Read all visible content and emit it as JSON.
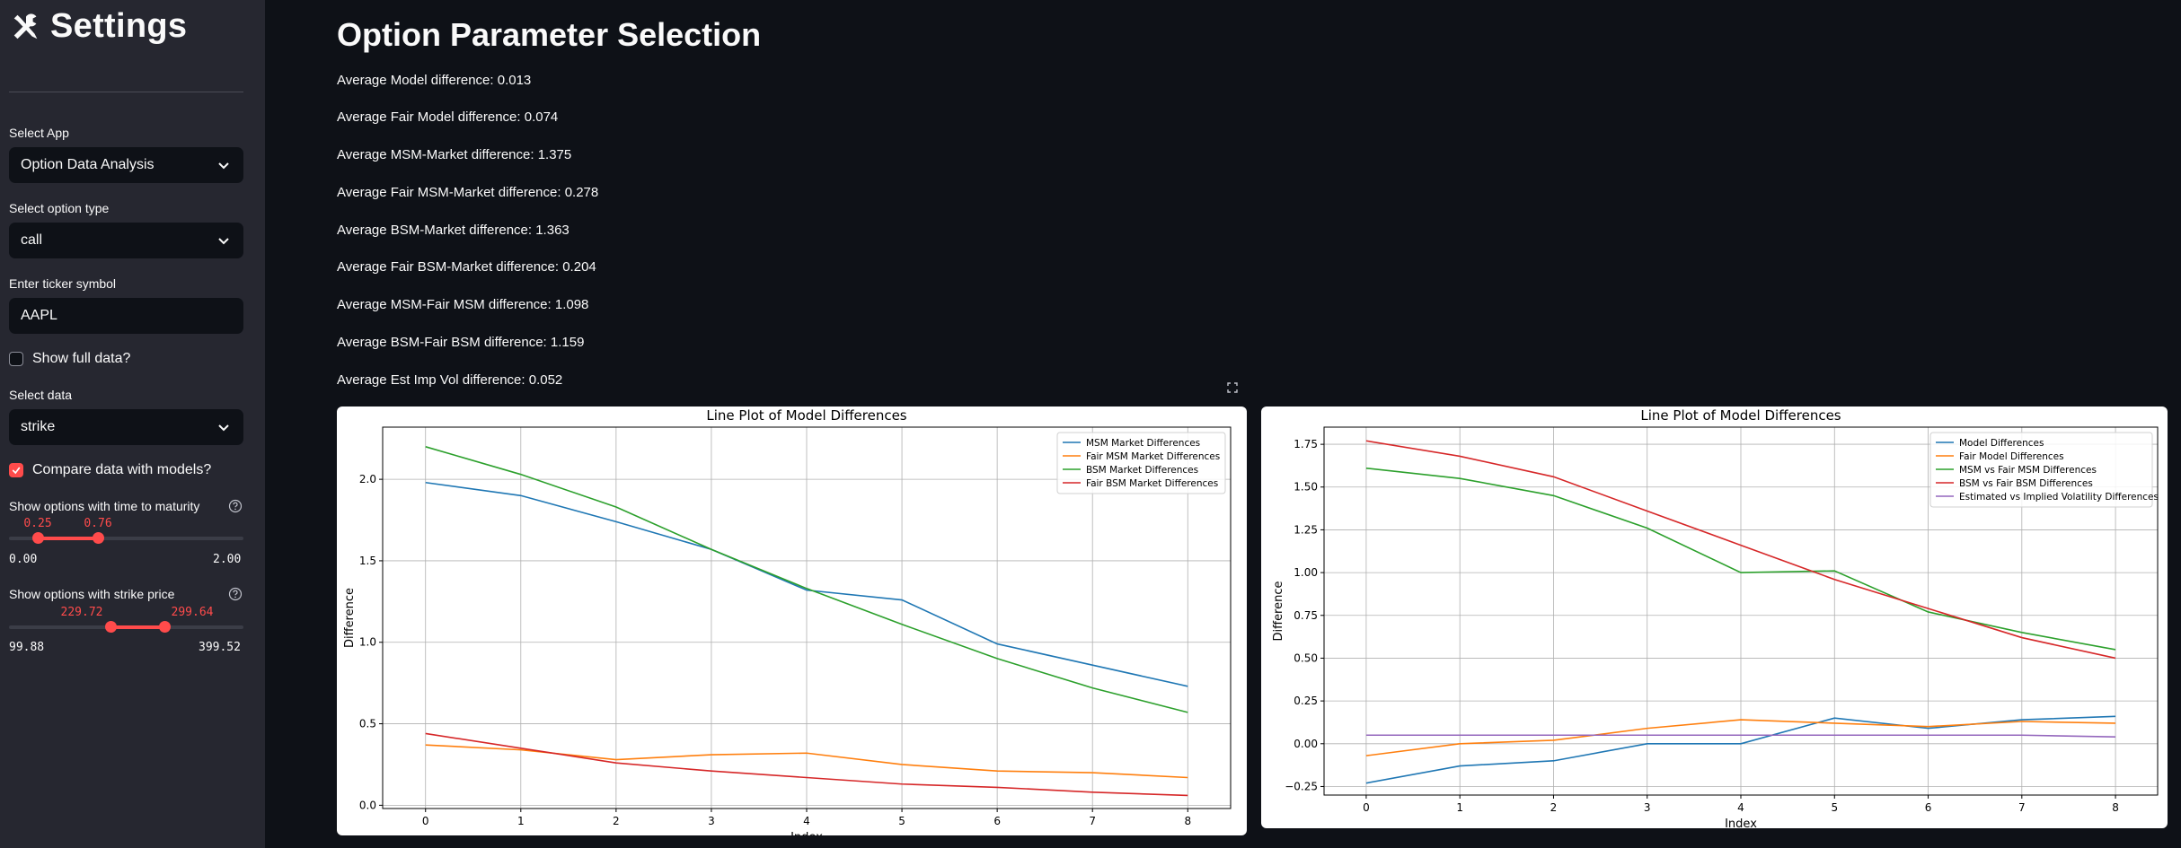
{
  "sidebar": {
    "title": "Settings",
    "select_app_label": "Select App",
    "select_app_value": "Option Data Analysis",
    "option_type_label": "Select option type",
    "option_type_value": "call",
    "ticker_label": "Enter ticker symbol",
    "ticker_value": "AAPL",
    "show_full_label": "Show full data?",
    "show_full_checked": false,
    "select_data_label": "Select data",
    "select_data_value": "strike",
    "compare_label": "Compare data with models?",
    "compare_checked": true,
    "maturity_label": "Show options with time to maturity",
    "maturity_low": "0.25",
    "maturity_high": "0.76",
    "maturity_min": "0.00",
    "maturity_max": "2.00",
    "strike_label": "Show options with strike price",
    "strike_low": "229.72",
    "strike_high": "299.64",
    "strike_min": "99.88",
    "strike_max": "399.52"
  },
  "main": {
    "title": "Option Parameter Selection",
    "stats": [
      "Average Model difference: 0.013",
      "Average Fair Model difference: 0.074",
      "Average MSM-Market difference: 1.375",
      "Average Fair MSM-Market difference: 0.278",
      "Average BSM-Market difference: 1.363",
      "Average Fair BSM-Market difference: 0.204",
      "Average MSM-Fair MSM difference: 1.098",
      "Average BSM-Fair BSM difference: 1.159",
      "Average Est Imp Vol difference: 0.052"
    ]
  },
  "colors": {
    "accent": "#ff4b4b",
    "blue": "#1f77b4",
    "orange": "#ff7f0e",
    "green": "#2ca02c",
    "red": "#d62728",
    "purple": "#9467bd"
  },
  "chart_data": [
    {
      "type": "line",
      "title": "Line Plot of Model Differences",
      "xlabel": "Index",
      "ylabel": "Difference",
      "x": [
        0,
        1,
        2,
        3,
        4,
        5,
        6,
        7,
        8
      ],
      "xlim": [
        -0.45,
        8.45
      ],
      "ylim": [
        -0.02,
        2.32
      ],
      "yticks": [
        "0.0",
        "0.5",
        "1.0",
        "1.5",
        "2.0"
      ],
      "ytick_values": [
        0,
        0.5,
        1.0,
        1.5,
        2.0
      ],
      "grid": true,
      "legend": "top-right",
      "series": [
        {
          "name": "MSM Market Differences",
          "color": "#1f77b4",
          "values": [
            1.98,
            1.9,
            1.74,
            1.57,
            1.32,
            1.26,
            0.99,
            0.86,
            0.73
          ]
        },
        {
          "name": "Fair MSM Market Differences",
          "color": "#ff7f0e",
          "values": [
            0.37,
            0.34,
            0.28,
            0.31,
            0.32,
            0.25,
            0.21,
            0.2,
            0.17
          ]
        },
        {
          "name": "BSM Market Differences",
          "color": "#2ca02c",
          "values": [
            2.2,
            2.03,
            1.83,
            1.57,
            1.33,
            1.11,
            0.9,
            0.72,
            0.57
          ]
        },
        {
          "name": "Fair BSM Market Differences",
          "color": "#d62728",
          "values": [
            0.44,
            0.35,
            0.26,
            0.21,
            0.17,
            0.13,
            0.11,
            0.08,
            0.06
          ]
        }
      ]
    },
    {
      "type": "line",
      "title": "Line Plot of Model Differences",
      "xlabel": "Index",
      "ylabel": "Difference",
      "x": [
        0,
        1,
        2,
        3,
        4,
        5,
        6,
        7,
        8
      ],
      "xlim": [
        -0.45,
        8.45
      ],
      "ylim": [
        -0.3,
        1.85
      ],
      "yticks": [
        "−0.25",
        "0.00",
        "0.25",
        "0.50",
        "0.75",
        "1.00",
        "1.25",
        "1.50",
        "1.75"
      ],
      "ytick_values": [
        -0.25,
        0,
        0.25,
        0.5,
        0.75,
        1.0,
        1.25,
        1.5,
        1.75
      ],
      "grid": true,
      "legend": "top-right",
      "series": [
        {
          "name": "Model Differences",
          "color": "#1f77b4",
          "values": [
            -0.23,
            -0.13,
            -0.1,
            0.0,
            0.0,
            0.15,
            0.09,
            0.14,
            0.16
          ]
        },
        {
          "name": "Fair Model Differences",
          "color": "#ff7f0e",
          "values": [
            -0.07,
            0.0,
            0.02,
            0.09,
            0.14,
            0.12,
            0.1,
            0.13,
            0.12
          ]
        },
        {
          "name": "MSM vs Fair MSM Differences",
          "color": "#2ca02c",
          "values": [
            1.61,
            1.55,
            1.45,
            1.26,
            1.0,
            1.01,
            0.77,
            0.65,
            0.55
          ]
        },
        {
          "name": "BSM vs Fair BSM Differences",
          "color": "#d62728",
          "values": [
            1.77,
            1.68,
            1.56,
            1.36,
            1.16,
            0.96,
            0.79,
            0.62,
            0.5
          ]
        },
        {
          "name": "Estimated vs Implied Volatility Differences",
          "color": "#9467bd",
          "values": [
            0.05,
            0.05,
            0.05,
            0.05,
            0.05,
            0.05,
            0.05,
            0.05,
            0.04
          ]
        }
      ]
    }
  ]
}
